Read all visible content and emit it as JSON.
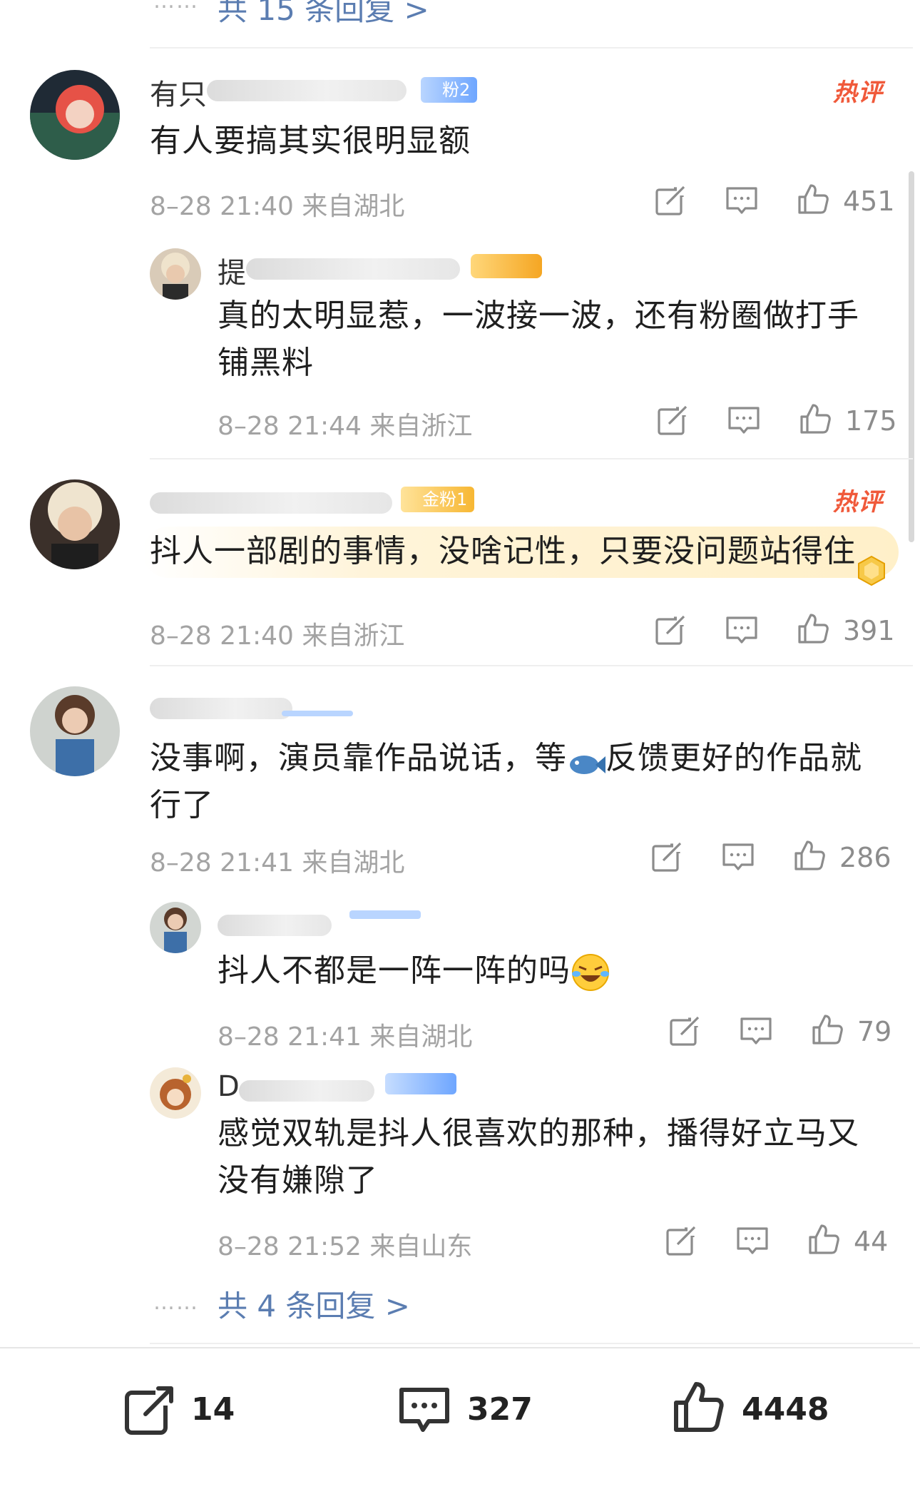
{
  "top_more": {
    "dots": "……",
    "text": "共 15 条回复 >"
  },
  "hot_label": "热评",
  "comments": [
    {
      "name": "有只",
      "badge": "粉2",
      "text": "有人要搞其实很明显额",
      "meta": "8–28 21:40 来自湖北",
      "likes": "451"
    },
    {
      "name": "提",
      "text": "真的太明显惹，一波接一波，还有粉圈做打手铺黑料",
      "meta": "8–28 21:44 来自浙江",
      "likes": "175"
    },
    {
      "name": "",
      "badge": "金粉1",
      "text": "抖人一部剧的事情，没啥记性，只要没问题站得住",
      "meta": "8–28 21:40 来自浙江",
      "likes": "391"
    },
    {
      "name": "",
      "text_a": "没事啊，演员靠作品说话，等",
      "text_b": "反馈更好的作品就行了",
      "meta": "8–28 21:41 来自湖北",
      "likes": "286"
    },
    {
      "name": "",
      "text": "抖人不都是一阵一阵的吗",
      "meta": "8–28 21:41 来自湖北",
      "likes": "79"
    },
    {
      "name": "D",
      "text": "感觉双轨是抖人很喜欢的那种，播得好立马又没有嫌隙了",
      "meta": "8–28 21:52 来自山东",
      "likes": "44"
    }
  ],
  "sub_more": {
    "dots": "……",
    "text": "共 4 条回复 >"
  },
  "bottom_bar": {
    "share": "14",
    "comment": "327",
    "like": "4448"
  },
  "icons": {
    "share": "share-icon",
    "comment": "comment-icon",
    "like": "thumb-up-icon",
    "emoji_fish": "fish-emoji-icon",
    "emoji_laugh": "laugh-cry-emoji-icon"
  },
  "colors": {
    "link": "#5b7db1",
    "hot": "#f0593a",
    "meta": "#a3a3a3"
  }
}
